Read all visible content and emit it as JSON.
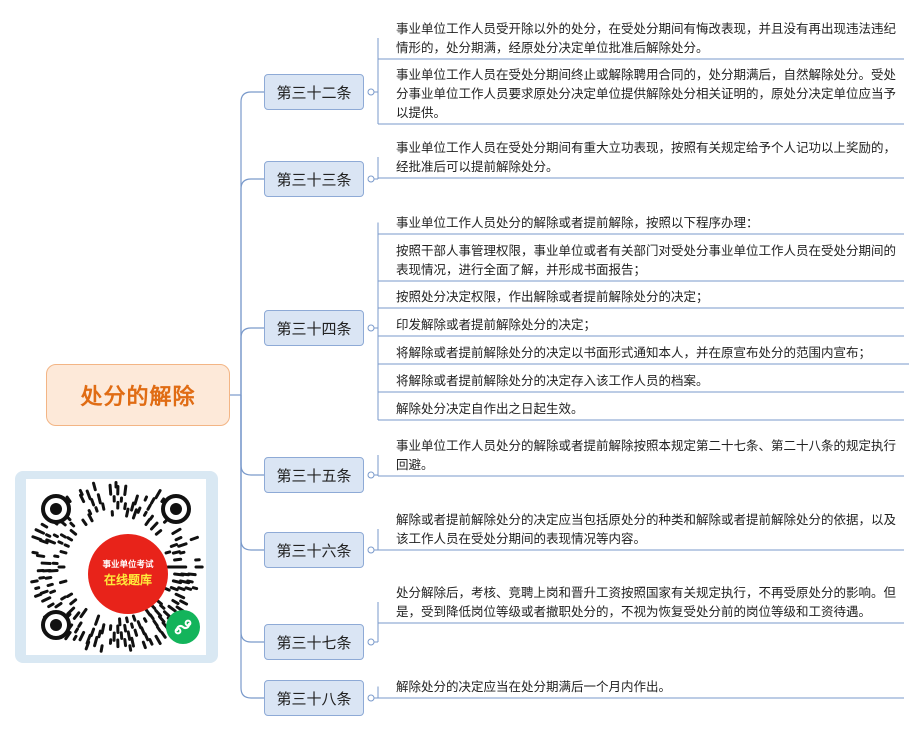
{
  "root": {
    "title": "处分的解除"
  },
  "articles": [
    {
      "label": "第三十二条",
      "items": [
        "事业单位工作人员受开除以外的处分，在受处分期间有悔改表现，并且没有再出现违法违纪情形的，处分期满，经原处分决定单位批准后解除处分。",
        "事业单位工作人员在受处分期间终止或解除聘用合同的，处分期满后，自然解除处分。受处分事业单位工作人员要求原处分决定单位提供解除处分相关证明的，原处分决定单位应当予以提供。"
      ]
    },
    {
      "label": "第三十三条",
      "items": [
        "事业单位工作人员在受处分期间有重大立功表现，按照有关规定给予个人记功以上奖励的，经批准后可以提前解除处分。"
      ]
    },
    {
      "label": "第三十四条",
      "items": [
        "事业单位工作人员处分的解除或者提前解除，按照以下程序办理：",
        "按照干部人事管理权限，事业单位或者有关部门对受处分事业单位工作人员在受处分期间的表现情况，进行全面了解，并形成书面报告；",
        "按照处分决定权限，作出解除或者提前解除处分的决定；",
        "印发解除或者提前解除处分的决定；",
        "将解除或者提前解除处分的决定以书面形式通知本人，并在原宣布处分的范围内宣布；",
        "将解除或者提前解除处分的决定存入该工作人员的档案。",
        "解除处分决定自作出之日起生效。"
      ]
    },
    {
      "label": "第三十五条",
      "items": [
        "事业单位工作人员处分的解除或者提前解除按照本规定第二十七条、第二十八条的规定执行回避。"
      ]
    },
    {
      "label": "第三十六条",
      "items": [
        "解除或者提前解除处分的决定应当包括原处分的种类和解除或者提前解除处分的依据，以及该工作人员在受处分期间的表现情况等内容。"
      ]
    },
    {
      "label": "第三十七条",
      "items": [
        "处分解除后，考核、竞聘上岗和晋升工资按照国家有关规定执行，不再受原处分的影响。但是，受到降低岗位等级或者撤职处分的，不视为恢复受处分前的岗位等级和工资待遇。"
      ]
    },
    {
      "label": "第三十八条",
      "items": [
        "解除处分的决定应当在处分期满后一个月内作出。"
      ]
    }
  ],
  "qr": {
    "line1": "事业单位考试",
    "line2": "在线题库",
    "icon": "mini-program-icon"
  },
  "colors": {
    "branch": "#7a9acb",
    "root_text": "#e06c14",
    "qr_red": "#e8231a",
    "qr_green": "#13b45b"
  }
}
